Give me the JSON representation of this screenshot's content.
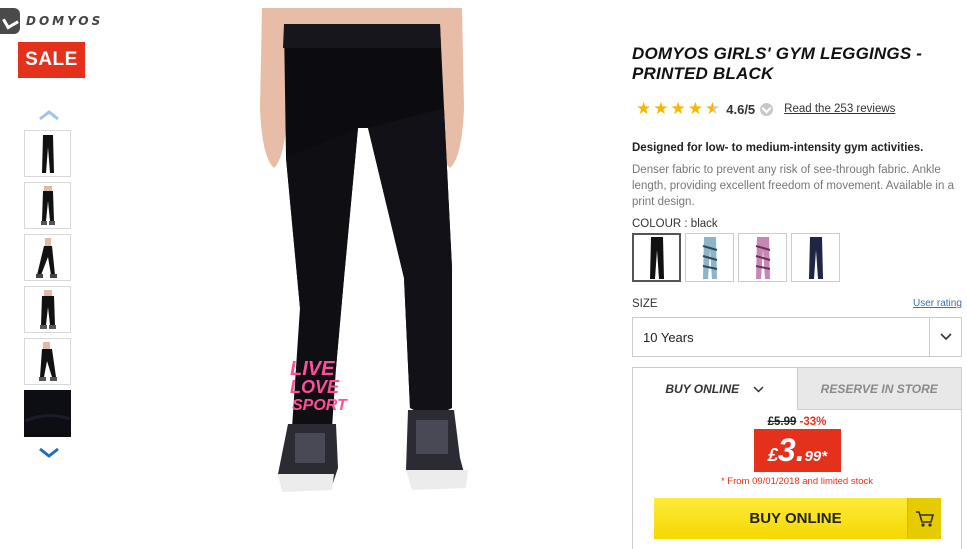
{
  "brand": {
    "name": "DOMYOS"
  },
  "badge": {
    "sale": "SALE"
  },
  "thumbnails": [
    {
      "icon": "leggings-front-thumb"
    },
    {
      "icon": "leggings-back-thumb"
    },
    {
      "icon": "leggings-side-thumb"
    },
    {
      "icon": "leggings-worn-thumb"
    },
    {
      "icon": "leggings-pose-thumb"
    },
    {
      "icon": "fabric-closeup-thumb"
    }
  ],
  "product": {
    "title": "DOMYOS GIRLS' GYM LEGGINGS - PRINTED BLACK",
    "image_print": [
      "LIVE",
      "LOVE",
      "SPORT"
    ],
    "rating": {
      "stars": 4.6,
      "value": "4.6/5",
      "reviews_link": "Read the 253 reviews"
    },
    "short_description": "Designed for low- to medium-intensity gym activities.",
    "long_description": "Denser fabric to prevent any risk of see-through fabric. Ankle length, providing excellent freedom of movement. Available in a print design."
  },
  "colour": {
    "label": "COLOUR : ",
    "selected": "black",
    "swatches": [
      {
        "name": "black",
        "color": "#111111"
      },
      {
        "name": "blue-print",
        "color": "#8fb3c7"
      },
      {
        "name": "pink-print",
        "color": "#c986b5"
      },
      {
        "name": "navy",
        "color": "#1f2542"
      }
    ]
  },
  "size": {
    "label": "SIZE",
    "user_rating_link": "User rating",
    "selected": "10 Years"
  },
  "purchase": {
    "tabs": {
      "buy_online": "BUY ONLINE",
      "reserve": "RESERVE IN STORE"
    },
    "old_price": "£5.99",
    "discount": "-33%",
    "price": {
      "currency": "£",
      "main": "3.",
      "decimals": "99*"
    },
    "stock_note": "* From 09/01/2018 and limited stock",
    "buy_button": "BUY ONLINE"
  },
  "colors": {
    "accent_red": "#e4311b",
    "button_yellow": "#f4d800",
    "star": "#f5b800"
  }
}
